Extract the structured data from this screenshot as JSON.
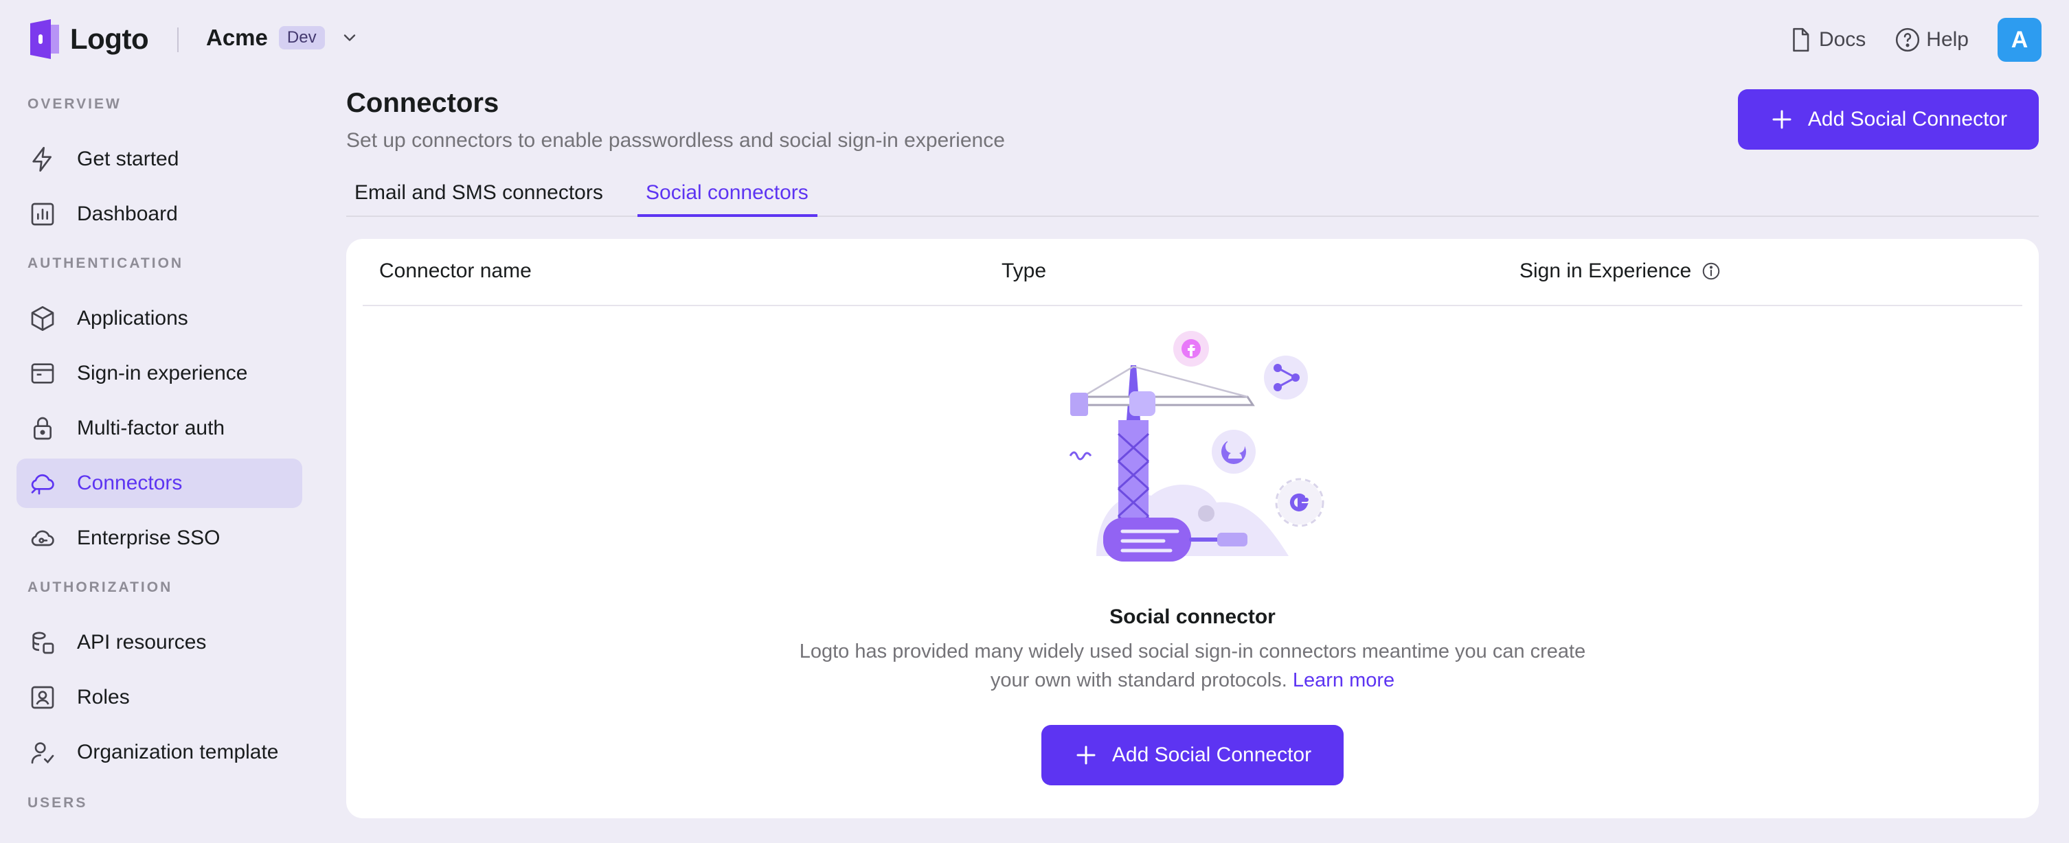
{
  "brand": {
    "name": "Logto",
    "accent": "#5d34f2",
    "logo_color": "#7c3aed"
  },
  "tenant": {
    "name": "Acme",
    "badge": "Dev"
  },
  "topbar": {
    "docs_label": "Docs",
    "help_label": "Help",
    "avatar_initial": "A",
    "avatar_color": "#2d9cf0"
  },
  "sidebar": {
    "sections": {
      "overview": "OVERVIEW",
      "authentication": "AUTHENTICATION",
      "authorization": "AUTHORIZATION",
      "users": "USERS"
    },
    "items": [
      {
        "label": "Get started",
        "icon": "lightning-icon"
      },
      {
        "label": "Dashboard",
        "icon": "chart-icon"
      },
      {
        "label": "Applications",
        "icon": "cube-icon"
      },
      {
        "label": "Sign-in experience",
        "icon": "browser-window-icon"
      },
      {
        "label": "Multi-factor auth",
        "icon": "lock-icon"
      },
      {
        "label": "Connectors",
        "icon": "cloud-connector-icon",
        "active": true
      },
      {
        "label": "Enterprise SSO",
        "icon": "cloud-key-icon"
      },
      {
        "label": "API resources",
        "icon": "api-stack-icon"
      },
      {
        "label": "Roles",
        "icon": "user-badge-icon"
      },
      {
        "label": "Organization template",
        "icon": "user-check-icon"
      }
    ]
  },
  "page": {
    "title": "Connectors",
    "subtitle": "Set up connectors to enable passwordless and social sign-in experience",
    "add_button": "Add Social Connector"
  },
  "tabs": [
    {
      "label": "Email and SMS connectors",
      "active": false
    },
    {
      "label": "Social connectors",
      "active": true
    }
  ],
  "table": {
    "columns": [
      "Connector name",
      "Type",
      "Sign in Experience"
    ]
  },
  "empty_state": {
    "title": "Social connector",
    "description": "Logto has provided many widely used social sign-in connectors meantime you can create your own with standard protocols.",
    "link": "Learn more",
    "button": "Add Social Connector"
  }
}
